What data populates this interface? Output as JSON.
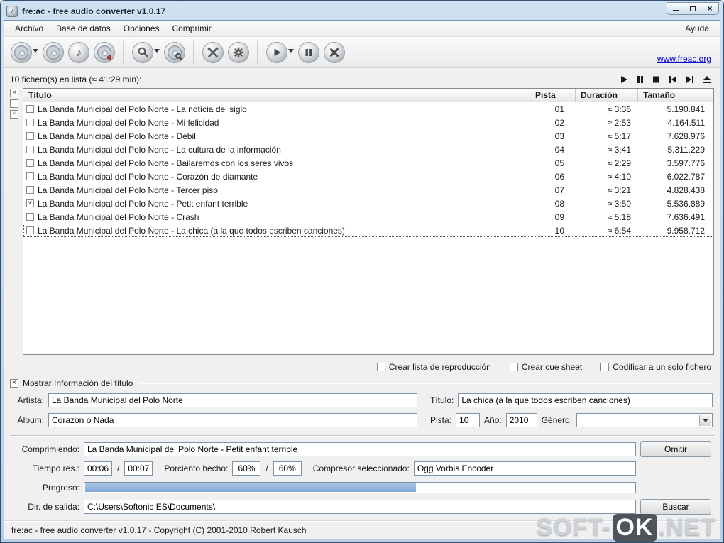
{
  "window": {
    "title": "fre:ac - free audio converter v1.0.17"
  },
  "menu": {
    "items": [
      "Archivo",
      "Base de datos",
      "Opciones",
      "Comprimir"
    ],
    "help": "Ayuda"
  },
  "toolbar": {
    "link": "www.freac.org",
    "buttons": [
      {
        "name": "add-cd-contents",
        "icon": "cd-add-icon",
        "dropdown": true
      },
      {
        "name": "rip-cd",
        "icon": "cd-icon",
        "dropdown": false
      },
      {
        "name": "add-files",
        "icon": "music-note-icon",
        "dropdown": false
      },
      {
        "name": "cd-info",
        "icon": "cd-dot-icon",
        "dropdown": false
      },
      {
        "name": "cddb-query",
        "icon": "magnifier-icon",
        "dropdown": true
      },
      {
        "name": "cddb-cd-query",
        "icon": "cd-magnifier-icon",
        "dropdown": false
      },
      {
        "name": "toolbox",
        "icon": "crossed-tools-icon",
        "dropdown": false
      },
      {
        "name": "settings",
        "icon": "gear-icon",
        "dropdown": false
      },
      {
        "name": "start-encoding",
        "icon": "play-circle-icon",
        "dropdown": true
      },
      {
        "name": "pause-encoding",
        "icon": "pause-circle-icon",
        "dropdown": false
      },
      {
        "name": "stop-encoding",
        "icon": "stop-circle-icon",
        "dropdown": false
      }
    ]
  },
  "joblist": {
    "status": "10 fichero(s) en lista (≈ 41:29 min):",
    "columns": {
      "title": "Título",
      "track": "Pista",
      "duration": "Duración",
      "size": "Tamaño"
    },
    "side_checks": {
      "all": "×",
      "none": "",
      "toggle": "×"
    },
    "rows": [
      {
        "title": "La Banda Municipal del Polo Norte - La notícia del siglo",
        "track": "01",
        "duration": "≈ 3:36",
        "size": "5.190.841",
        "checked": false,
        "selected": false
      },
      {
        "title": "La Banda Municipal del Polo Norte - Mi felicidad",
        "track": "02",
        "duration": "≈ 2:53",
        "size": "4.164.511",
        "checked": false,
        "selected": false
      },
      {
        "title": "La Banda Municipal del Polo Norte - Débil",
        "track": "03",
        "duration": "≈ 5:17",
        "size": "7.628.976",
        "checked": false,
        "selected": false
      },
      {
        "title": "La Banda Municipal del Polo Norte - La cultura de la información",
        "track": "04",
        "duration": "≈ 3:41",
        "size": "5.311.229",
        "checked": false,
        "selected": false
      },
      {
        "title": "La Banda Municipal del Polo Norte - Bailaremos con los seres vivos",
        "track": "05",
        "duration": "≈ 2:29",
        "size": "3.597.776",
        "checked": false,
        "selected": false
      },
      {
        "title": "La Banda Municipal del Polo Norte - Corazón de diamante",
        "track": "06",
        "duration": "≈ 4:10",
        "size": "6.022.787",
        "checked": false,
        "selected": false
      },
      {
        "title": "La Banda Municipal del Polo Norte - Tercer piso",
        "track": "07",
        "duration": "≈ 3:21",
        "size": "4.828.438",
        "checked": false,
        "selected": false
      },
      {
        "title": "La Banda Municipal del Polo Norte - Petit enfant terrible",
        "track": "08",
        "duration": "≈ 3:50",
        "size": "5.536.889",
        "checked": true,
        "selected": false
      },
      {
        "title": "La Banda Municipal del Polo Norte - Crash",
        "track": "09",
        "duration": "≈ 5:18",
        "size": "7.636.491",
        "checked": false,
        "selected": false
      },
      {
        "title": "La Banda Municipal del Polo Norte - La chica (a la que todos escriben canciones)",
        "track": "10",
        "duration": "≈ 6:54",
        "size": "9.958.712",
        "checked": false,
        "selected": true
      }
    ]
  },
  "glyphs": {
    "checked": "×"
  },
  "options": {
    "playlist": "Crear lista de reproducción",
    "cue_sheet": "Crear cue sheet",
    "single_file": "Codificar a un solo fichero"
  },
  "tag_info": {
    "group_label": "Mostrar Información del título",
    "group_checked": "×",
    "artist_label": "Artista:",
    "artist": "La Banda Municipal del Polo Norte",
    "title_label": "Título:",
    "title": "La chica (a la que todos escriben canciones)",
    "album_label": "Álbum:",
    "album": "Corazón o Nada",
    "track_label": "Pista:",
    "track": "10",
    "year_label": "Año:",
    "year": "2010",
    "genre_label": "Género:",
    "genre": ""
  },
  "encoding": {
    "current_label": "Comprimiendo:",
    "current": "La Banda Municipal del Polo Norte - Petit enfant terrible",
    "skip_button": "Omitir",
    "time_label": "Tiempo res.:",
    "time_track": "00:06",
    "time_total": "00:07",
    "separator": "/",
    "percent_label": "Porciento hecho:",
    "percent_track": "60%",
    "percent_total": "60%",
    "encoder_label": "Compresor seleccionado:",
    "encoder": "Ogg Vorbis Encoder",
    "progress_label": "Progreso:",
    "progress_percent": 60,
    "outdir_label": "Dir. de salida:",
    "outdir": "C:\\Users\\Softonic ES\\Documents\\",
    "browse_button": "Buscar"
  },
  "statusbar": {
    "text": "fre:ac - free audio converter v1.0.17 - Copyright (C) 2001-2010 Robert Kausch"
  },
  "watermark": {
    "part1": "SOFT-",
    "part2": "OK",
    "part3": ".NET"
  }
}
